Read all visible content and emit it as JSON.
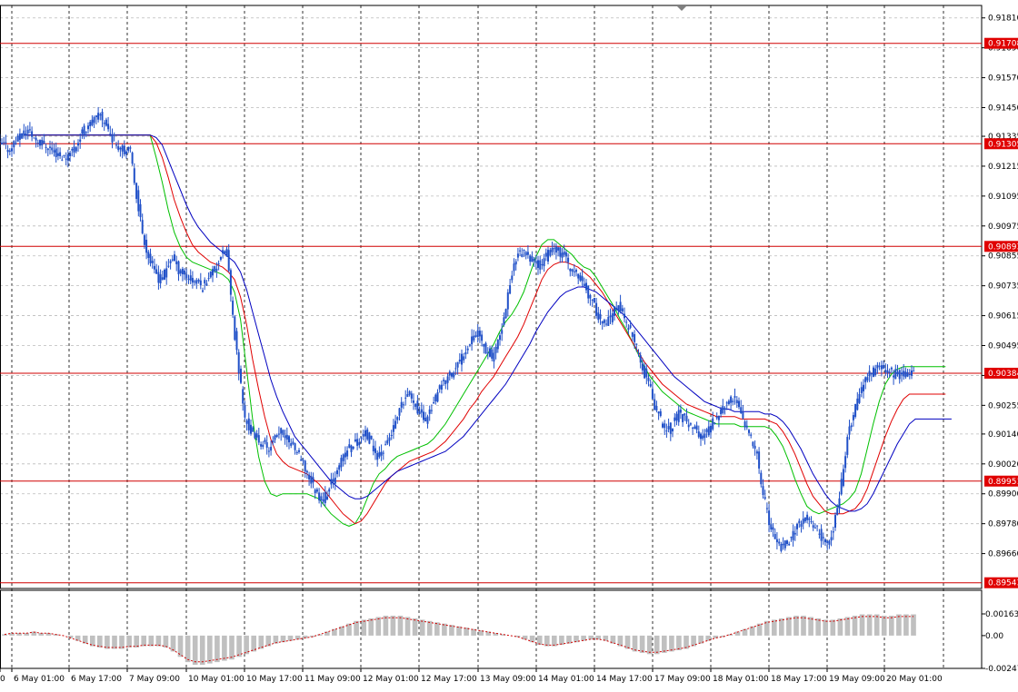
{
  "chart_data": {
    "type": "candlestick",
    "price_axis": {
      "ylim": [
        0.8952,
        0.9186
      ],
      "ticks": [
        "0.91810",
        "0.91690",
        "0.91570",
        "0.91450",
        "0.91335",
        "0.91215",
        "0.91095",
        "0.90975",
        "0.90855",
        "0.90735",
        "0.90615",
        "0.90495",
        "0.90375",
        "0.90255",
        "0.90140",
        "0.90020",
        "0.89900",
        "0.89780",
        "0.89660"
      ]
    },
    "time_axis": {
      "labels": [
        "0",
        "6 May 01:00",
        "6 May 17:00",
        "7 May 09:00",
        "10 May 01:00",
        "10 May 17:00",
        "11 May 09:00",
        "12 May 01:00",
        "12 May 17:00",
        "13 May 09:00",
        "14 May 01:00",
        "14 May 17:00",
        "17 May 09:00",
        "18 May 01:00",
        "18 May 17:00",
        "19 May 09:00",
        "20 May 01:00"
      ]
    },
    "levels": [
      "0.91708",
      "0.91305",
      "0.90893",
      "0.90384",
      "0.89951",
      "0.89543"
    ],
    "current_price": "0.90384",
    "moving_averages": [
      {
        "color": "#00c000",
        "values": [
          0.9134,
          0.9134,
          0.9134,
          0.9134,
          0.9134,
          0.9134,
          0.9134,
          0.9134,
          0.9134,
          0.9134,
          0.9134,
          0.9134,
          0.9134,
          0.9134,
          0.9134,
          0.9134,
          0.9134,
          0.9134,
          0.9134,
          0.9134,
          0.9134,
          0.9134,
          0.9125,
          0.9115,
          0.9104,
          0.9095,
          0.9089,
          0.9085,
          0.9083,
          0.9082,
          0.9081,
          0.908,
          0.9079,
          0.9078,
          0.9076,
          0.9071,
          0.906,
          0.904,
          0.902,
          0.9005,
          0.8995,
          0.899,
          0.8989,
          0.899,
          0.899,
          0.899,
          0.899,
          0.899,
          0.8989,
          0.8988,
          0.8985,
          0.8982,
          0.898,
          0.8978,
          0.8977,
          0.8978,
          0.8982,
          0.8988,
          0.8994,
          0.8998,
          0.9,
          0.9003,
          0.9005,
          0.9006,
          0.9007,
          0.9008,
          0.9009,
          0.901,
          0.9012,
          0.9015,
          0.9018,
          0.9022,
          0.9026,
          0.903,
          0.9034,
          0.9038,
          0.9042,
          0.9046,
          0.905,
          0.9055,
          0.9059,
          0.9062,
          0.9066,
          0.9071,
          0.9078,
          0.9085,
          0.909,
          0.9092,
          0.9092,
          0.909,
          0.9088,
          0.9086,
          0.9083,
          0.9081,
          0.908,
          0.9077,
          0.9073,
          0.9069,
          0.9065,
          0.906,
          0.9056,
          0.9051,
          0.9046,
          0.9041,
          0.9037,
          0.9034,
          0.9031,
          0.9029,
          0.9027,
          0.9025,
          0.9023,
          0.9022,
          0.9021,
          0.902,
          0.9019,
          0.9018,
          0.9018,
          0.9018,
          0.9018,
          0.9017,
          0.9017,
          0.9017,
          0.9017,
          0.9017,
          0.9016,
          0.9013,
          0.9009,
          0.9003,
          0.8996,
          0.899,
          0.8985,
          0.8983,
          0.8982,
          0.8983,
          0.8984,
          0.8985,
          0.8986,
          0.8988,
          0.8991,
          0.8998,
          0.9008,
          0.9018,
          0.9027,
          0.9034,
          0.9038,
          0.904,
          0.9041,
          0.9041,
          0.9041,
          0.9041,
          0.9041,
          0.9041,
          0.9041,
          0.9041
        ]
      },
      {
        "color": "#e00000",
        "values": [
          0.9134,
          0.9134,
          0.9134,
          0.9134,
          0.9134,
          0.9134,
          0.9134,
          0.9134,
          0.9134,
          0.9134,
          0.9134,
          0.9134,
          0.9134,
          0.9134,
          0.9134,
          0.9134,
          0.9134,
          0.9134,
          0.9134,
          0.9134,
          0.9134,
          0.9134,
          0.9131,
          0.9125,
          0.9117,
          0.9108,
          0.9101,
          0.9095,
          0.909,
          0.9087,
          0.9085,
          0.9083,
          0.9082,
          0.9081,
          0.9079,
          0.9076,
          0.9069,
          0.9058,
          0.9044,
          0.9032,
          0.9021,
          0.9012,
          0.9006,
          0.9003,
          0.9001,
          0.9,
          0.8999,
          0.8998,
          0.8996,
          0.8994,
          0.8991,
          0.8988,
          0.8985,
          0.8982,
          0.898,
          0.8978,
          0.8979,
          0.8982,
          0.8986,
          0.899,
          0.8994,
          0.8997,
          0.8999,
          0.9001,
          0.9003,
          0.9004,
          0.9005,
          0.9006,
          0.9007,
          0.9009,
          0.9011,
          0.9014,
          0.9017,
          0.902,
          0.9024,
          0.9027,
          0.9031,
          0.9034,
          0.9037,
          0.9041,
          0.9045,
          0.9049,
          0.9053,
          0.9058,
          0.9064,
          0.907,
          0.9076,
          0.908,
          0.9082,
          0.9083,
          0.9083,
          0.9082,
          0.9081,
          0.9079,
          0.9077,
          0.9074,
          0.9071,
          0.9067,
          0.9063,
          0.9059,
          0.9055,
          0.9051,
          0.9047,
          0.9043,
          0.904,
          0.9037,
          0.9034,
          0.9032,
          0.903,
          0.9028,
          0.9026,
          0.9025,
          0.9024,
          0.9023,
          0.9022,
          0.9021,
          0.9021,
          0.9021,
          0.9021,
          0.902,
          0.902,
          0.902,
          0.902,
          0.902,
          0.9019,
          0.9018,
          0.9015,
          0.9011,
          0.9006,
          0.9,
          0.8994,
          0.8989,
          0.8986,
          0.8983,
          0.8982,
          0.8982,
          0.8982,
          0.8983,
          0.8984,
          0.8987,
          0.8992,
          0.8999,
          0.9006,
          0.9013,
          0.9019,
          0.9024,
          0.9028,
          0.903,
          0.903,
          0.903,
          0.903,
          0.903,
          0.903,
          0.903
        ]
      },
      {
        "color": "#0000c0",
        "values": [
          0.9134,
          0.9134,
          0.9134,
          0.9134,
          0.9134,
          0.9134,
          0.9134,
          0.9134,
          0.9134,
          0.9134,
          0.9134,
          0.9134,
          0.9134,
          0.9134,
          0.9134,
          0.9134,
          0.9134,
          0.9134,
          0.9134,
          0.9134,
          0.9134,
          0.9134,
          0.9133,
          0.913,
          0.9124,
          0.9118,
          0.9112,
          0.9106,
          0.9101,
          0.9097,
          0.9094,
          0.9091,
          0.9089,
          0.9087,
          0.9085,
          0.9083,
          0.9079,
          0.9072,
          0.9063,
          0.9054,
          0.9045,
          0.9036,
          0.9029,
          0.9023,
          0.9018,
          0.9013,
          0.901,
          0.9007,
          0.9004,
          0.9001,
          0.8998,
          0.8995,
          0.8993,
          0.8991,
          0.8989,
          0.8988,
          0.8988,
          0.8989,
          0.8991,
          0.8993,
          0.8995,
          0.8997,
          0.8999,
          0.9,
          0.9001,
          0.9002,
          0.9003,
          0.9004,
          0.9005,
          0.9006,
          0.9007,
          0.9009,
          0.9011,
          0.9013,
          0.9016,
          0.9019,
          0.9022,
          0.9025,
          0.9028,
          0.9031,
          0.9034,
          0.9038,
          0.9042,
          0.9046,
          0.905,
          0.9055,
          0.9059,
          0.9063,
          0.9066,
          0.9069,
          0.9071,
          0.9072,
          0.9073,
          0.9073,
          0.9072,
          0.9071,
          0.9069,
          0.9067,
          0.9065,
          0.9063,
          0.9061,
          0.9058,
          0.9055,
          0.9052,
          0.9049,
          0.9046,
          0.9043,
          0.904,
          0.9037,
          0.9035,
          0.9033,
          0.9031,
          0.9029,
          0.9027,
          0.9026,
          0.9025,
          0.9024,
          0.9024,
          0.9023,
          0.9023,
          0.9023,
          0.9023,
          0.9023,
          0.9022,
          0.9022,
          0.9021,
          0.9019,
          0.9016,
          0.9012,
          0.9008,
          0.9003,
          0.8998,
          0.8994,
          0.899,
          0.8987,
          0.8985,
          0.8984,
          0.8983,
          0.8983,
          0.8984,
          0.8986,
          0.899,
          0.8995,
          0.9,
          0.9005,
          0.901,
          0.9014,
          0.9018,
          0.902,
          0.902,
          0.902,
          0.902,
          0.902,
          0.902,
          0.902
        ]
      }
    ],
    "close": [
      0.913,
      0.9128,
      0.9132,
      0.9134,
      0.9136,
      0.9133,
      0.9131,
      0.913,
      0.9128,
      0.9126,
      0.9125,
      0.9127,
      0.913,
      0.9135,
      0.9138,
      0.914,
      0.9142,
      0.9138,
      0.9133,
      0.913,
      0.9128,
      0.9127,
      0.911,
      0.9095,
      0.9085,
      0.908,
      0.9075,
      0.908,
      0.9085,
      0.908,
      0.9078,
      0.9076,
      0.9075,
      0.9073,
      0.9078,
      0.908,
      0.9085,
      0.9088,
      0.906,
      0.904,
      0.902,
      0.9015,
      0.9012,
      0.901,
      0.9008,
      0.9012,
      0.9015,
      0.9012,
      0.901,
      0.9005,
      0.9,
      0.8995,
      0.899,
      0.8988,
      0.8992,
      0.8998,
      0.9003,
      0.9008,
      0.901,
      0.9012,
      0.9014,
      0.901,
      0.9005,
      0.9008,
      0.9013,
      0.9018,
      0.9025,
      0.903,
      0.9028,
      0.9022,
      0.902,
      0.9025,
      0.903,
      0.9035,
      0.9038,
      0.904,
      0.9045,
      0.905,
      0.9055,
      0.9053,
      0.9048,
      0.9045,
      0.905,
      0.906,
      0.9075,
      0.9085,
      0.9087,
      0.9085,
      0.9083,
      0.9082,
      0.9085,
      0.9088,
      0.9087,
      0.9086,
      0.908,
      0.9078,
      0.9076,
      0.907,
      0.9065,
      0.906,
      0.9058,
      0.9062,
      0.9066,
      0.906,
      0.9055,
      0.9048,
      0.904,
      0.9035,
      0.9025,
      0.902,
      0.9015,
      0.9018,
      0.9022,
      0.902,
      0.9018,
      0.9015,
      0.9012,
      0.9016,
      0.902,
      0.9024,
      0.9026,
      0.9028,
      0.9026,
      0.9018,
      0.9012,
      0.9005,
      0.899,
      0.8978,
      0.8972,
      0.8968,
      0.897,
      0.8974,
      0.8978,
      0.898,
      0.8978,
      0.8975,
      0.8972,
      0.897,
      0.898,
      0.8995,
      0.9012,
      0.9022,
      0.903,
      0.9036,
      0.9038,
      0.904,
      0.9041,
      0.9039,
      0.9038,
      0.9038,
      0.9039,
      0.9038
    ]
  },
  "oscillator": {
    "ticks": [
      "0.001636",
      "0.00",
      "-0.002472"
    ],
    "ylim": [
      -0.002472,
      0.001636
    ],
    "values": [
      0.0001,
      0.0002,
      0.0002,
      0.0002,
      0.0003,
      0.0002,
      0.0002,
      0.0001,
      0.0,
      -0.0002,
      -0.0004,
      -0.0006,
      -0.0008,
      -0.0009,
      -0.001,
      -0.001,
      -0.001,
      -0.0009,
      -0.0009,
      -0.0008,
      -0.0008,
      -0.0008,
      -0.0009,
      -0.0012,
      -0.0016,
      -0.002,
      -0.0022,
      -0.0022,
      -0.0021,
      -0.002,
      -0.0019,
      -0.0018,
      -0.0016,
      -0.0014,
      -0.0012,
      -0.001,
      -0.0008,
      -0.0006,
      -0.0005,
      -0.0004,
      -0.0003,
      -0.0002,
      -0.0001,
      0.0001,
      0.0003,
      0.0005,
      0.0007,
      0.0009,
      0.0011,
      0.0012,
      0.0013,
      0.0014,
      0.0015,
      0.0015,
      0.0015,
      0.0014,
      0.0013,
      0.0012,
      0.0011,
      0.001,
      0.0009,
      0.0008,
      0.0007,
      0.0006,
      0.0005,
      0.0004,
      0.0003,
      0.0002,
      0.0001,
      0.0,
      -0.0001,
      -0.0003,
      -0.0005,
      -0.0007,
      -0.0008,
      -0.0008,
      -0.0007,
      -0.0006,
      -0.0005,
      -0.0004,
      -0.0003,
      -0.0003,
      -0.0004,
      -0.0006,
      -0.0008,
      -0.001,
      -0.0012,
      -0.0013,
      -0.0014,
      -0.0014,
      -0.0013,
      -0.0012,
      -0.0011,
      -0.001,
      -0.0008,
      -0.0006,
      -0.0004,
      -0.0002,
      -0.0001,
      0.0001,
      0.0003,
      0.0005,
      0.0007,
      0.0009,
      0.0011,
      0.0012,
      0.0013,
      0.0014,
      0.0015,
      0.0015,
      0.0014,
      0.0013,
      0.0012,
      0.0012,
      0.0013,
      0.0014,
      0.0015,
      0.0016,
      0.0016,
      0.0016,
      0.0015,
      0.0015,
      0.0016,
      0.0016,
      0.0016
    ]
  }
}
